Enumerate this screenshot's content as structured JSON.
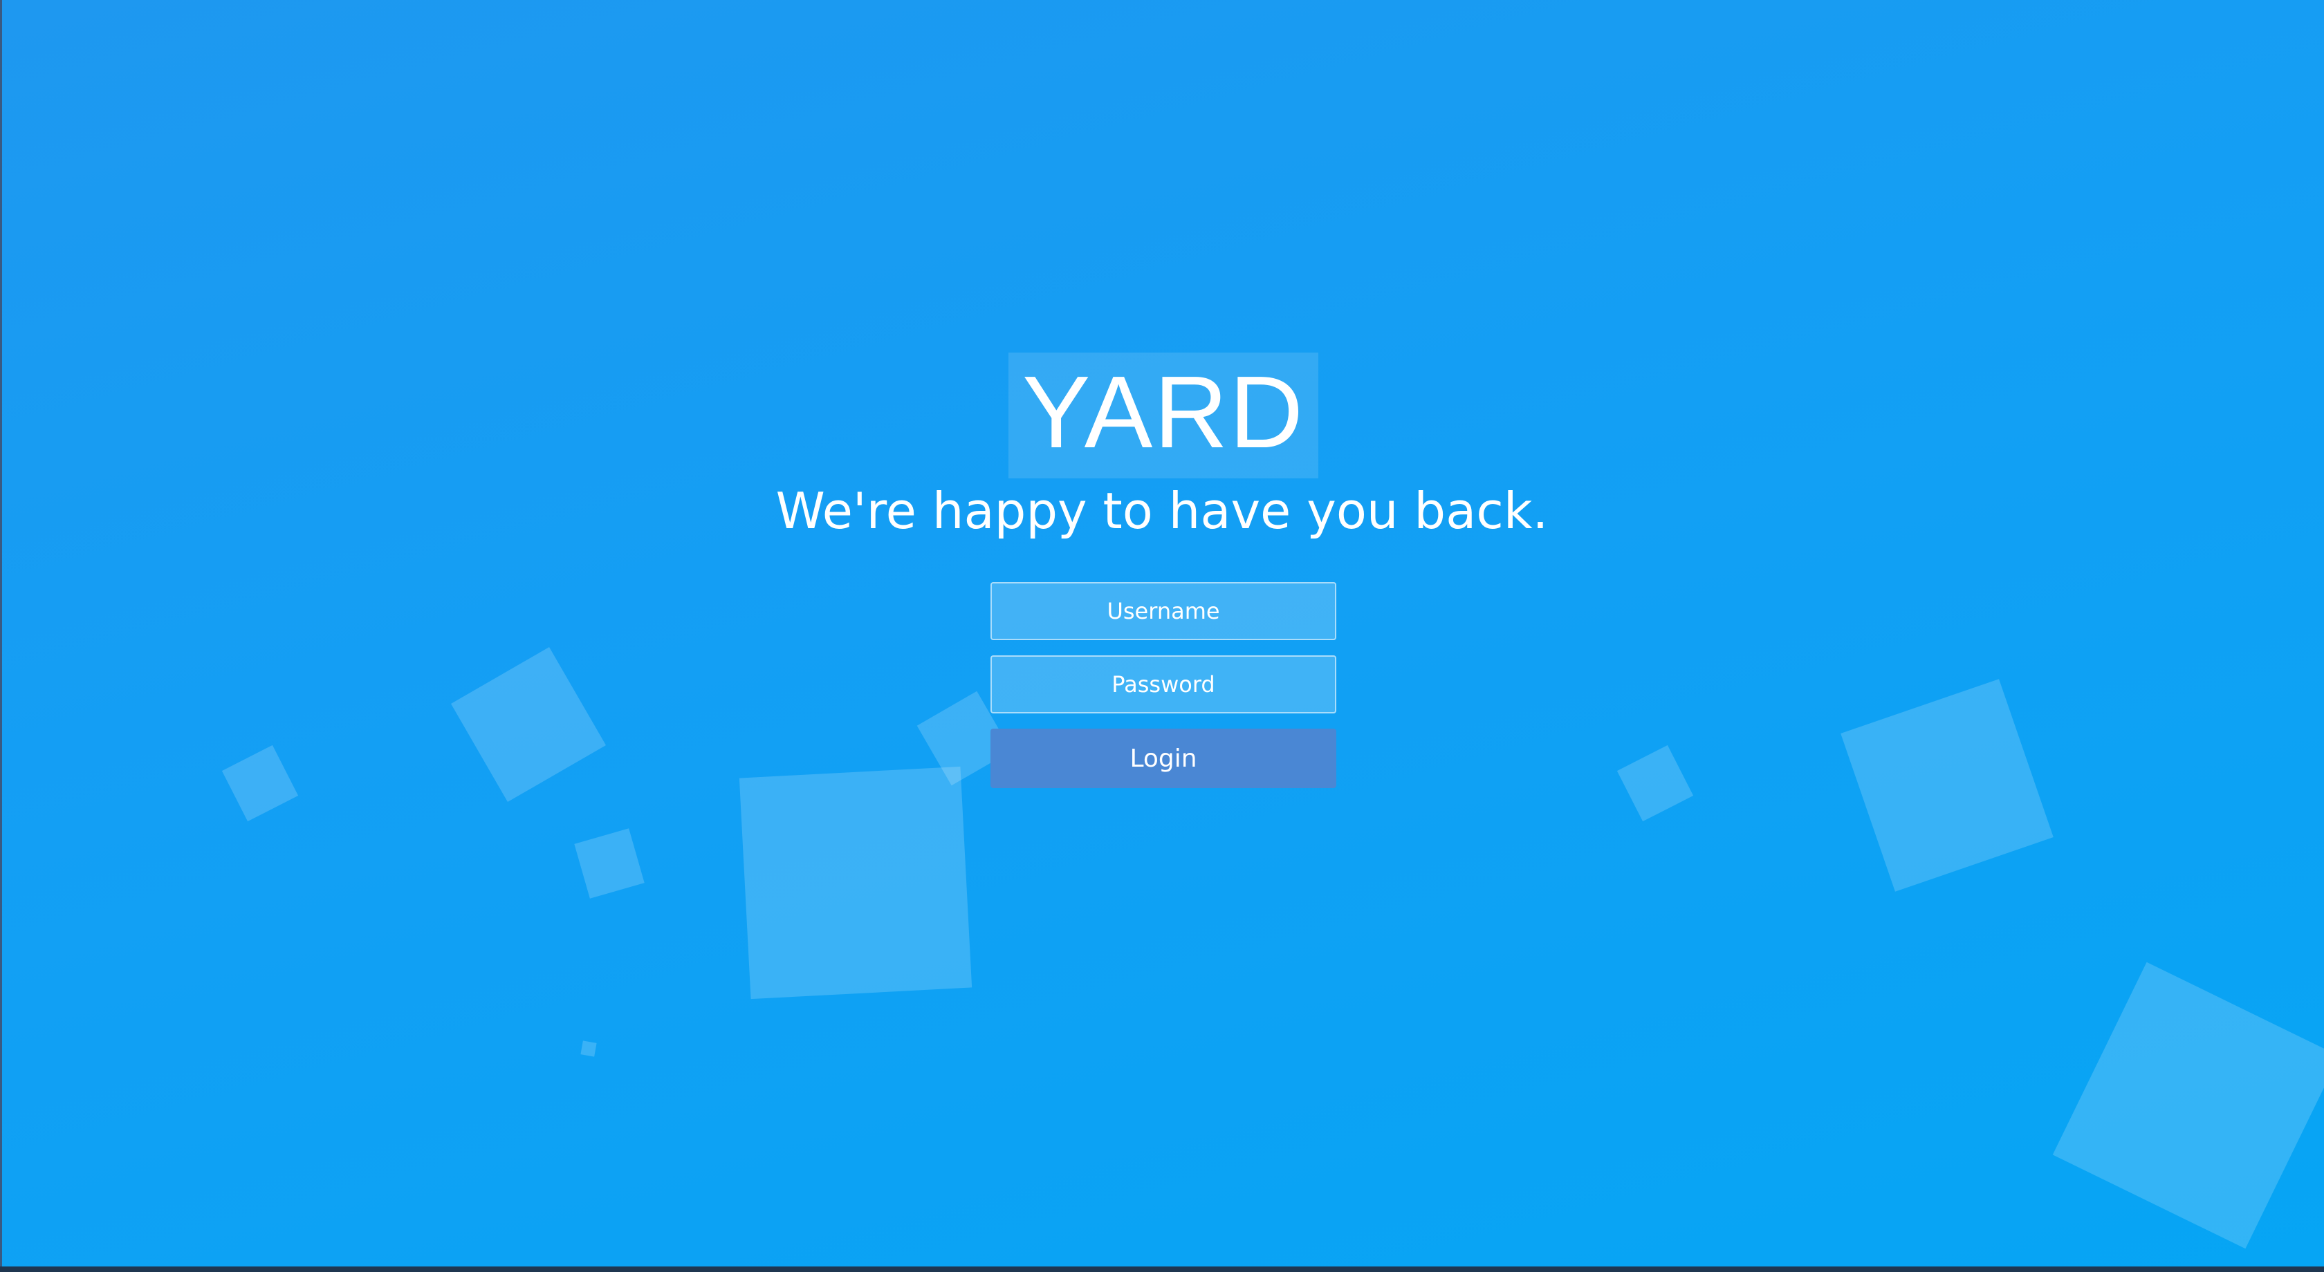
{
  "logo": {
    "text": "YARD"
  },
  "tagline": "We're happy to have you back.",
  "form": {
    "username_placeholder": "Username",
    "username_value": "",
    "password_placeholder": "Password",
    "password_value": "",
    "login_label": "Login"
  },
  "colors": {
    "background_top": "#1e98f0",
    "background_bottom": "#06a5f4",
    "login_button": "#4a87d4",
    "text": "#ffffff"
  }
}
